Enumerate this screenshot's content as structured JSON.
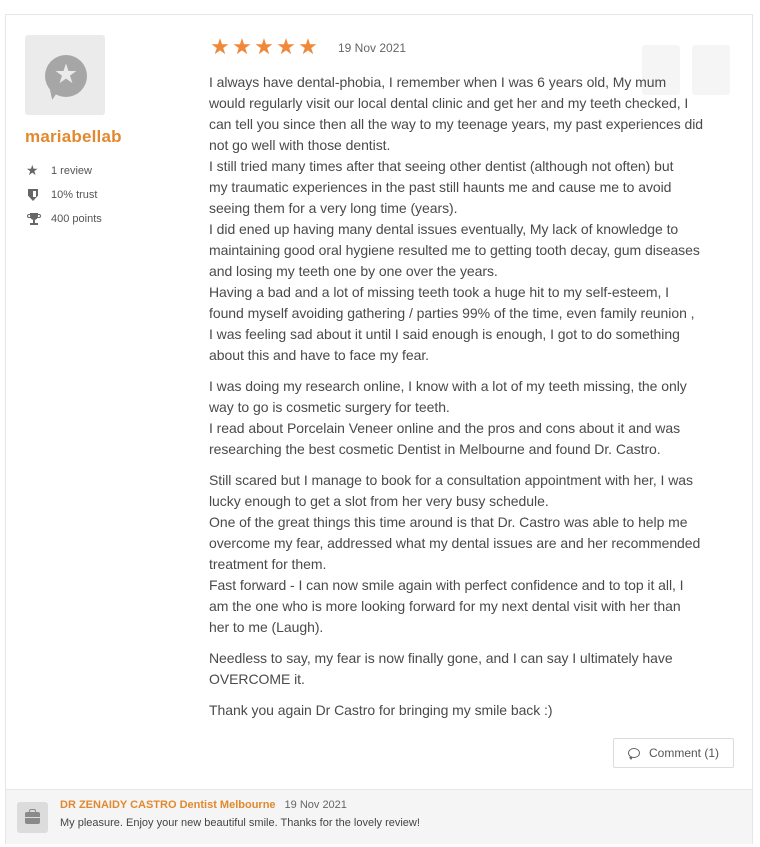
{
  "reviewer": {
    "username": "mariabellab",
    "avatar_icon": "star-speech-bubble-icon",
    "stats": [
      {
        "icon": "star-icon",
        "text": "1 review"
      },
      {
        "icon": "shield-icon",
        "text": "10% trust"
      },
      {
        "icon": "trophy-icon",
        "text": "400 points"
      }
    ]
  },
  "review": {
    "rating": 5,
    "rating_max": 5,
    "star_glyph": "★",
    "date": "19 Nov 2021",
    "paragraphs": [
      [
        "I always have dental-phobia, I remember when I was 6 years old, My mum",
        "would regularly visit our local dental clinic and get her and my teeth checked, I",
        "can tell you since then all the way to my teenage years, my past experiences did",
        "not go well with those dentist.",
        "I still tried many times after that seeing other dentist (although not often) but",
        "my traumatic experiences in the past still haunts me and cause me to avoid",
        "seeing them for a very long time (years).",
        "I did ened up having many dental issues eventually, My lack of knowledge to",
        "maintaining good oral hygiene resulted me to getting tooth decay, gum diseases",
        "and losing my teeth one by one over the years.",
        "Having a bad and a lot of missing teeth took a huge hit to my self-esteem, I",
        "found myself avoiding gathering / parties 99% of the time, even family reunion ,",
        "I was feeling sad about it until I said enough is enough, I got to do something",
        "about this and have to face my fear."
      ],
      [
        "I was doing my research online, I know with a lot of my teeth missing, the only",
        "way to go is cosmetic surgery for teeth.",
        "I read about Porcelain Veneer online and the pros and cons about it and was",
        "researching the best cosmetic Dentist in Melbourne and found Dr. Castro."
      ],
      [
        "Still scared but I manage to book for a consultation appointment with her, I was",
        "lucky enough to get a slot from her very busy schedule.",
        "One of the great things this time around is that Dr. Castro was able to help me",
        "overcome my fear, addressed what my dental issues are and her recommended",
        "treatment for them.",
        "Fast forward - I can now smile again with perfect confidence and to top it all, I",
        "am the one who is more looking forward for my next dental visit with her than",
        "her to me (Laugh)."
      ],
      [
        "Needless to say, my fear is now finally gone, and I can say I ultimately have",
        "OVERCOME it."
      ],
      [
        "Thank you again Dr Castro for bringing my smile back :)"
      ]
    ],
    "comment_button": {
      "icon": "comment-bubble-icon",
      "label": "Comment (1)"
    }
  },
  "reply": {
    "icon": "briefcase-icon",
    "author": "DR ZENAIDY CASTRO Dentist Melbourne",
    "date": "19 Nov 2021",
    "message": "My pleasure. Enjoy your new beautiful smile. Thanks for the lovely review!"
  },
  "colors": {
    "accent_orange": "#e2892f",
    "star_orange": "#f0883a",
    "text": "#4a4a4a",
    "reply_bg": "#f5f5f5"
  }
}
